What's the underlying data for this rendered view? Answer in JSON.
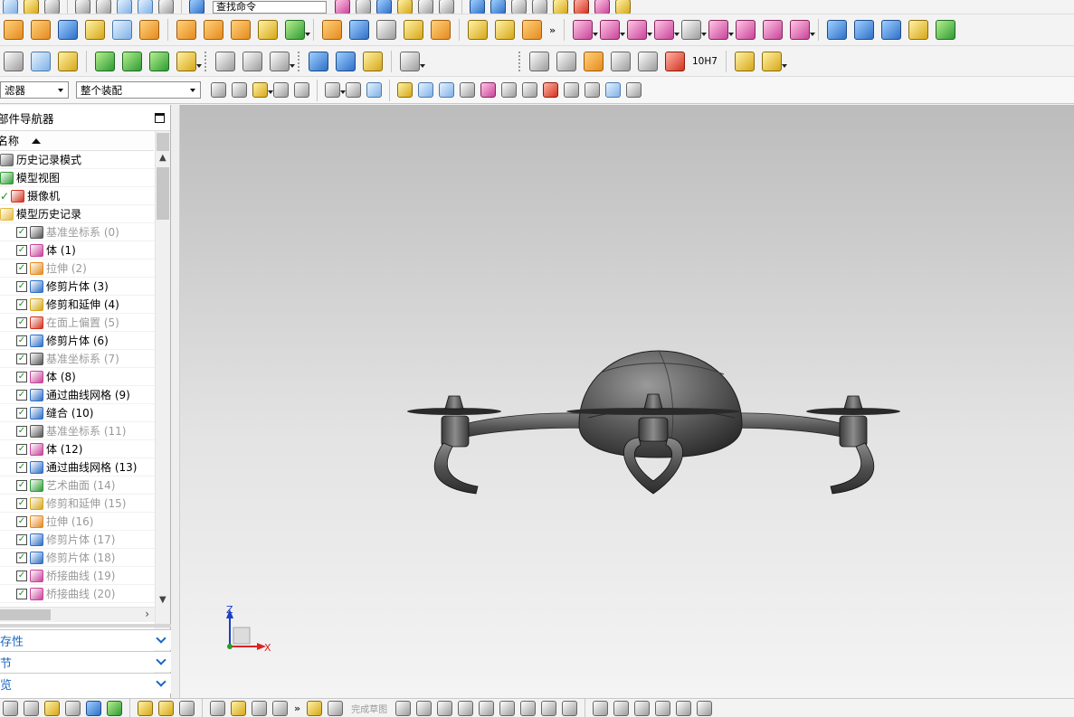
{
  "toolbar": {
    "command_finder_text": "查找命令",
    "overflow_glyph": "»",
    "row1_icons": [
      "block-icon",
      "cylinder-icon",
      "cone-icon",
      "sphere-icon",
      "extrude-icon",
      "revolve-icon",
      "hole-icon",
      "boss-icon",
      "pocket-icon",
      "pad-icon",
      "emboss-icon",
      "thicken-icon",
      "trim-body-icon",
      "split-body-icon",
      "patch-icon",
      "mirror-icon",
      "sew-icon",
      "unite-icon",
      "subtract-icon",
      "intersect-icon",
      "offset-face-icon",
      "draft-icon",
      "blend-icon",
      "chamfer-icon",
      "shell-icon",
      "surface-grid-icon",
      "swept-icon",
      "ruled-icon",
      "through-curves-icon",
      "bridge-icon",
      "extension-icon"
    ],
    "row2_icons": [
      "layer-icon",
      "feature-group-icon",
      "measure-icon",
      "check-icon",
      "analysis-icon",
      "text-abc-icon",
      "curve-icon",
      "spline-icon",
      "section-icon",
      "thread-icon",
      "spring-icon",
      "bearing-icon",
      "constraint-icon",
      "triangle-icon",
      "table-icon",
      "pattern-icon",
      "grid-view-icon",
      "note-icon",
      "weld-icon",
      "tolerance-icon",
      "assembly-icon",
      "component-icon"
    ],
    "tolerance_label": "10H7"
  },
  "selection_bar": {
    "filter_value": "滤器",
    "scope_value": "整个装配"
  },
  "navigator": {
    "title": "部件导航器",
    "column_name": "名称",
    "items": [
      {
        "label": "历史记录模式",
        "checked": false,
        "dim": false,
        "icon": "clock-icon",
        "color": "#6b6b6b",
        "indent": 0
      },
      {
        "label": "模型视图",
        "checked": false,
        "dim": false,
        "icon": "model-view-icon",
        "color": "#2e9b34",
        "indent": 0
      },
      {
        "label": "摄像机",
        "checked": true,
        "dim": false,
        "icon": "camera-icon",
        "color": "#d2321d",
        "indent": 0
      },
      {
        "label": "模型历史记录",
        "checked": false,
        "dim": false,
        "icon": "folder-icon",
        "color": "#e5b93a",
        "indent": 0
      },
      {
        "label": "基准坐标系 (0)",
        "checked": true,
        "dim": true,
        "icon": "datum-csys-icon",
        "color": "#555555",
        "indent": 1
      },
      {
        "label": "体 (1)",
        "checked": true,
        "dim": false,
        "icon": "body-icon",
        "color": "#c8439a",
        "indent": 1
      },
      {
        "label": "拉伸 (2)",
        "checked": true,
        "dim": true,
        "icon": "extrude-icon",
        "color": "#e58a1f",
        "indent": 1
      },
      {
        "label": "修剪片体 (3)",
        "checked": true,
        "dim": false,
        "icon": "trim-sheet-icon",
        "color": "#2f6fc7",
        "indent": 1
      },
      {
        "label": "修剪和延伸 (4)",
        "checked": true,
        "dim": false,
        "icon": "trim-extend-icon",
        "color": "#d6a718",
        "indent": 1
      },
      {
        "label": "在面上偏置 (5)",
        "checked": true,
        "dim": true,
        "icon": "offset-on-face-icon",
        "color": "#d2321d",
        "indent": 1
      },
      {
        "label": "修剪片体 (6)",
        "checked": true,
        "dim": false,
        "icon": "trim-sheet-icon",
        "color": "#2f6fc7",
        "indent": 1
      },
      {
        "label": "基准坐标系 (7)",
        "checked": true,
        "dim": true,
        "icon": "datum-csys-icon",
        "color": "#555555",
        "indent": 1
      },
      {
        "label": "体 (8)",
        "checked": true,
        "dim": false,
        "icon": "body-icon",
        "color": "#c8439a",
        "indent": 1
      },
      {
        "label": "通过曲线网格 (9)",
        "checked": true,
        "dim": false,
        "icon": "curve-mesh-icon",
        "color": "#2f6fc7",
        "indent": 1
      },
      {
        "label": "缝合 (10)",
        "checked": true,
        "dim": false,
        "icon": "sew-icon",
        "color": "#2f6fc7",
        "indent": 1
      },
      {
        "label": "基准坐标系 (11)",
        "checked": true,
        "dim": true,
        "icon": "datum-csys-icon",
        "color": "#555555",
        "indent": 1
      },
      {
        "label": "体 (12)",
        "checked": true,
        "dim": false,
        "icon": "body-icon",
        "color": "#c8439a",
        "indent": 1
      },
      {
        "label": "通过曲线网格 (13)",
        "checked": true,
        "dim": false,
        "icon": "curve-mesh-icon",
        "color": "#2f6fc7",
        "indent": 1
      },
      {
        "label": "艺术曲面 (14)",
        "checked": true,
        "dim": true,
        "icon": "studio-surface-icon",
        "color": "#2e9b34",
        "indent": 1
      },
      {
        "label": "修剪和延伸 (15)",
        "checked": true,
        "dim": true,
        "icon": "trim-extend-icon",
        "color": "#d6a718",
        "indent": 1
      },
      {
        "label": "拉伸 (16)",
        "checked": true,
        "dim": true,
        "icon": "extrude-icon",
        "color": "#e58a1f",
        "indent": 1
      },
      {
        "label": "修剪片体 (17)",
        "checked": true,
        "dim": true,
        "icon": "trim-sheet-icon",
        "color": "#2f6fc7",
        "indent": 1
      },
      {
        "label": "修剪片体 (18)",
        "checked": true,
        "dim": true,
        "icon": "trim-sheet-icon",
        "color": "#2f6fc7",
        "indent": 1
      },
      {
        "label": "桥接曲线 (19)",
        "checked": true,
        "dim": true,
        "icon": "bridge-curve-icon",
        "color": "#c8439a",
        "indent": 1
      },
      {
        "label": "桥接曲线 (20)",
        "checked": true,
        "dim": true,
        "icon": "bridge-curve-icon",
        "color": "#c8439a",
        "indent": 1
      }
    ]
  },
  "panels": [
    {
      "label": "依存性"
    },
    {
      "label": "细节"
    },
    {
      "label": "预览"
    }
  ],
  "viewport": {
    "axis_z_label": "Z",
    "axis_x_label": "X",
    "model_name": "quadcopter-drone"
  },
  "bottom_bar": {
    "ghost_text": "完成草图"
  }
}
